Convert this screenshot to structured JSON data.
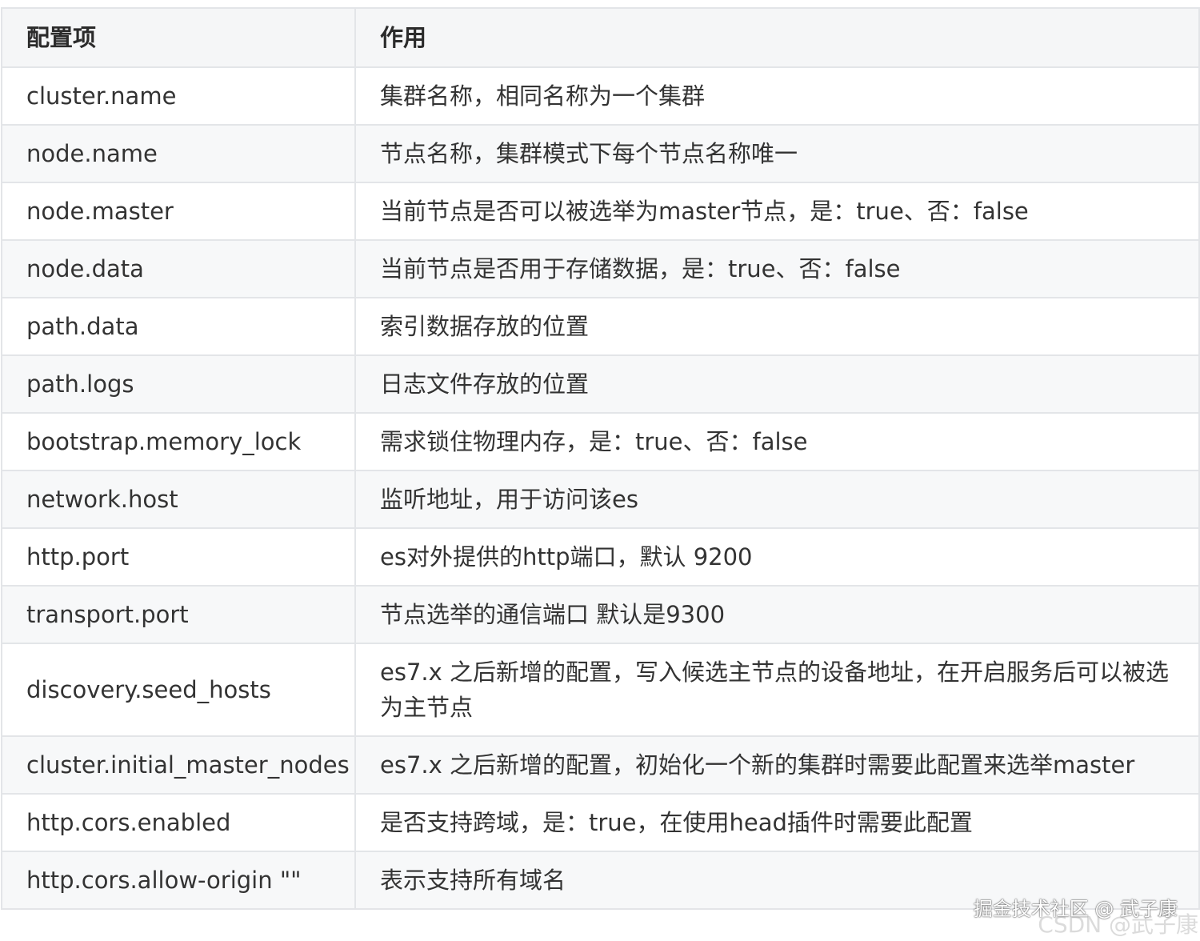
{
  "table": {
    "headers": [
      "配置项",
      "作用"
    ],
    "rows": [
      {
        "key": "cluster.name",
        "desc": "集群名称，相同名称为一个集群"
      },
      {
        "key": "node.name",
        "desc": "节点名称，集群模式下每个节点名称唯一"
      },
      {
        "key": "node.master",
        "desc": "当前节点是否可以被选举为master节点，是：true、否：false"
      },
      {
        "key": "node.data",
        "desc": "当前节点是否用于存储数据，是：true、否：false"
      },
      {
        "key": "path.data",
        "desc": "索引数据存放的位置"
      },
      {
        "key": "path.logs",
        "desc": "日志文件存放的位置"
      },
      {
        "key": "bootstrap.memory_lock",
        "desc": "需求锁住物理内存，是：true、否：false"
      },
      {
        "key": "network.host",
        "desc": "监听地址，用于访问该es"
      },
      {
        "key": "http.port",
        "desc": "es对外提供的http端口，默认 9200"
      },
      {
        "key": "transport.port",
        "desc": "节点选举的通信端口 默认是9300"
      },
      {
        "key": "discovery.seed_hosts",
        "desc": "es7.x 之后新增的配置，写入候选主节点的设备地址，在开启服务后可以被选为主节点"
      },
      {
        "key": "cluster.initial_master_nodes",
        "desc": "es7.x 之后新增的配置，初始化一个新的集群时需要此配置来选举master"
      },
      {
        "key": "http.cors.enabled",
        "desc": "是否支持跨域，是：true，在使用head插件时需要此配置"
      },
      {
        "key": "http.cors.allow-origin \"\"",
        "desc": "表示支持所有域名"
      }
    ]
  },
  "watermarks": {
    "juejin": "掘金技术社区 @ 武子康",
    "csdn": "CSDN @武子康"
  }
}
